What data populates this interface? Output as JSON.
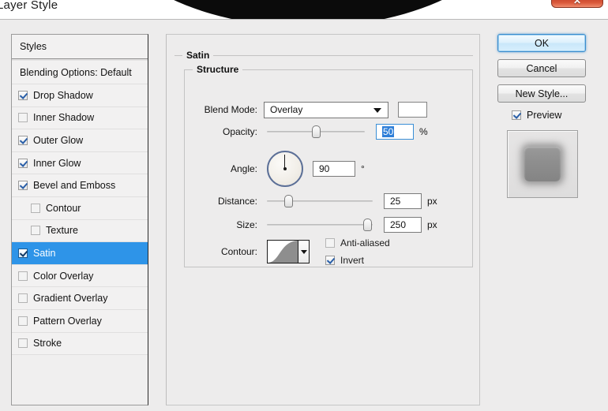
{
  "window": {
    "title": "Layer Style",
    "close_label": "✕"
  },
  "styles_panel": {
    "header": "Styles",
    "blending_options": "Blending Options: Default",
    "items": [
      {
        "label": "Drop Shadow",
        "checked": true,
        "indent": false,
        "selected": false
      },
      {
        "label": "Inner Shadow",
        "checked": false,
        "indent": false,
        "selected": false
      },
      {
        "label": "Outer Glow",
        "checked": true,
        "indent": false,
        "selected": false
      },
      {
        "label": "Inner Glow",
        "checked": true,
        "indent": false,
        "selected": false
      },
      {
        "label": "Bevel and Emboss",
        "checked": true,
        "indent": false,
        "selected": false
      },
      {
        "label": "Contour",
        "checked": false,
        "indent": true,
        "selected": false
      },
      {
        "label": "Texture",
        "checked": false,
        "indent": true,
        "selected": false
      },
      {
        "label": "Satin",
        "checked": true,
        "indent": false,
        "selected": true
      },
      {
        "label": "Color Overlay",
        "checked": false,
        "indent": false,
        "selected": false
      },
      {
        "label": "Gradient Overlay",
        "checked": false,
        "indent": false,
        "selected": false
      },
      {
        "label": "Pattern Overlay",
        "checked": false,
        "indent": false,
        "selected": false
      },
      {
        "label": "Stroke",
        "checked": false,
        "indent": false,
        "selected": false
      }
    ]
  },
  "satin": {
    "group_title": "Satin",
    "structure_title": "Structure",
    "blend_mode": {
      "label": "Blend Mode:",
      "value": "Overlay",
      "swatch_color": "#ffffff"
    },
    "opacity": {
      "label": "Opacity:",
      "value": "50",
      "unit": "%",
      "slider_percent": 50
    },
    "angle": {
      "label": "Angle:",
      "value": "90",
      "unit": "°"
    },
    "distance": {
      "label": "Distance:",
      "value": "25",
      "unit": "px",
      "slider_percent": 20
    },
    "size": {
      "label": "Size:",
      "value": "250",
      "unit": "px",
      "slider_percent": 95
    },
    "contour": {
      "label": "Contour:",
      "anti_aliased_label": "Anti-aliased",
      "anti_aliased_checked": false,
      "invert_label": "Invert",
      "invert_checked": true
    }
  },
  "buttons": {
    "ok": "OK",
    "cancel": "Cancel",
    "new_style": "New Style...",
    "preview_label": "Preview",
    "preview_checked": true
  },
  "colors": {
    "selection_blue": "#2e94e8",
    "default_button_blue": "#3c8dcd",
    "dialog_background": "#edecec",
    "close_button_red": "#c6432a"
  }
}
